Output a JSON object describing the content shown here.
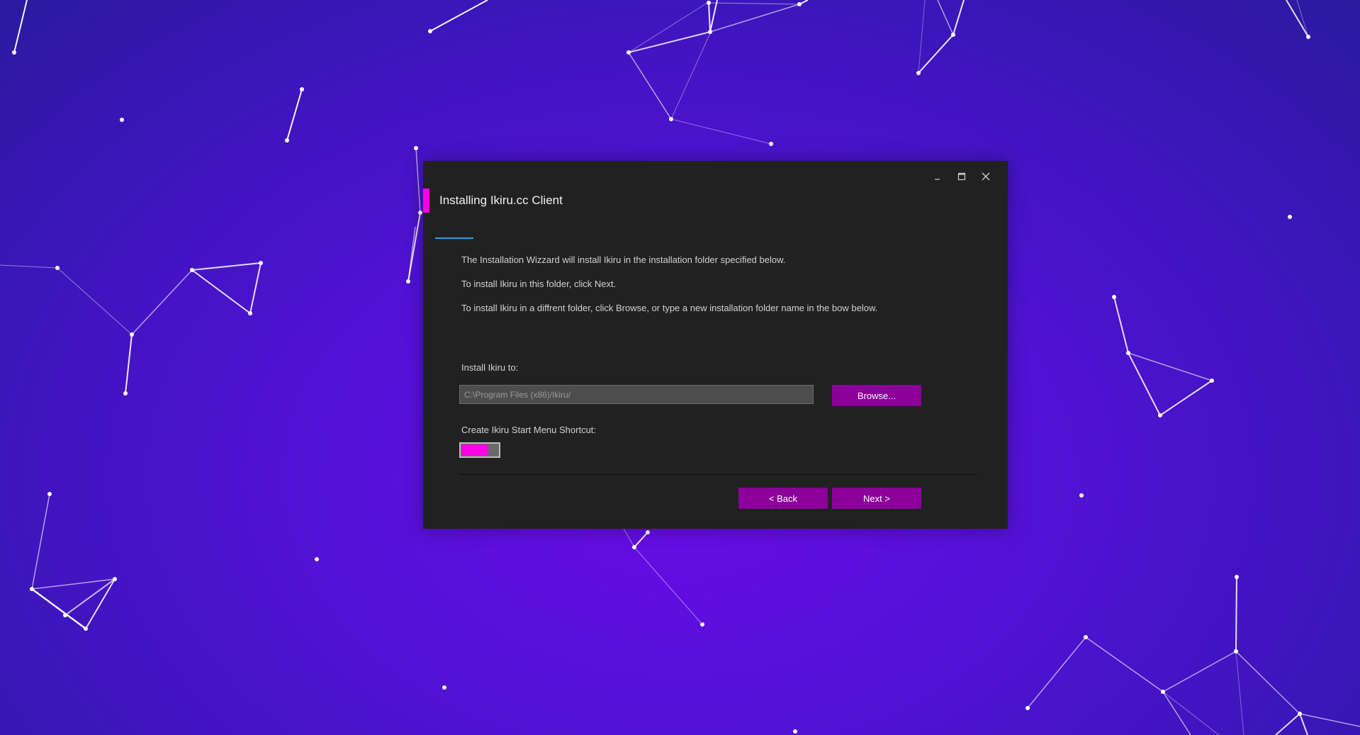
{
  "window": {
    "title": "Installing Ikiru.cc Client",
    "controls": {
      "minimize": "_",
      "maximize": "☐",
      "close": "✕"
    }
  },
  "intro": {
    "line1": "The Installation Wizzard will install Ikiru in the installation folder specified below.",
    "line2": "To install Ikiru in this folder, click Next.",
    "line3": "To install Ikiru in a diffrent folder, click Browse, or type a new installation folder name in the bow below."
  },
  "install_path": {
    "label": "Install Ikiru to:",
    "value": "C:\\Program Files (x86)/Ikiru/"
  },
  "browse_label": "Browse...",
  "shortcut": {
    "label": "Create Ikiru Start Menu Shortcut:",
    "enabled": true
  },
  "nav": {
    "back_label": "< Back",
    "next_label": "Next >"
  },
  "colors": {
    "accent": "#ff00e6",
    "button": "#8a0099",
    "window_bg": "#212121",
    "progress": "#1ea7e6"
  }
}
